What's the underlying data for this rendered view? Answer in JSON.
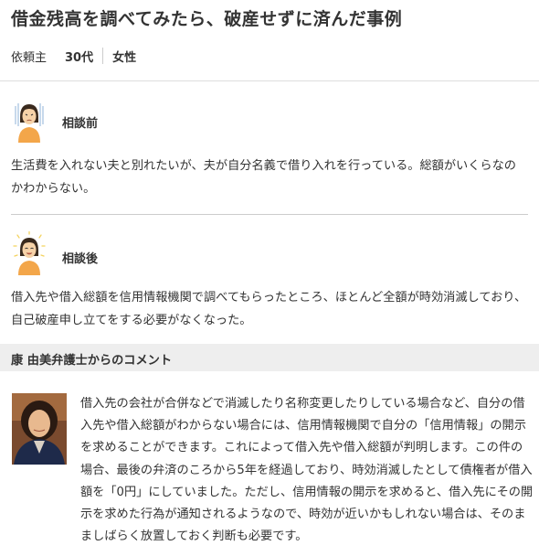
{
  "title": "借金残高を調べてみたら、破産せずに済んだ事例",
  "client": {
    "label": "依頼主",
    "age": "30代",
    "gender": "女性"
  },
  "before": {
    "label": "相談前",
    "text": "生活費を入れない夫と別れたいが、夫が自分名義で借り入れを行っている。総額がいくらなのかわからない。",
    "icon": "worried-woman-icon"
  },
  "after": {
    "label": "相談後",
    "text": "借入先や借入総額を信用情報機関で調べてもらったところ、ほとんど全額が時効消滅しており、自己破産申し立てをする必要がなくなった。",
    "icon": "happy-woman-icon"
  },
  "comment": {
    "heading": "康 由美弁護士からのコメント",
    "text": "借入先の会社が合併などで消滅したり名称変更したりしている場合など、自分の借入先や借入総額がわからない場合には、信用情報機関で自分の「信用情報」の開示を求めることができます。これによって借入先や借入総額が判明します。この件の場合、最後の弁済のころから5年を経過しており、時効消滅したとして債権者が借入額を「0円」にしていました。ただし、信用情報の開示を求めると、借入先にその開示を求めた行為が通知されるようなので、時効が近いかもしれない場合は、そのまましばらく放置しておく判断も必要です。"
  },
  "colors": {
    "divider": "#dddddd",
    "comment_bar": "#eeeeee",
    "text": "#333333"
  }
}
